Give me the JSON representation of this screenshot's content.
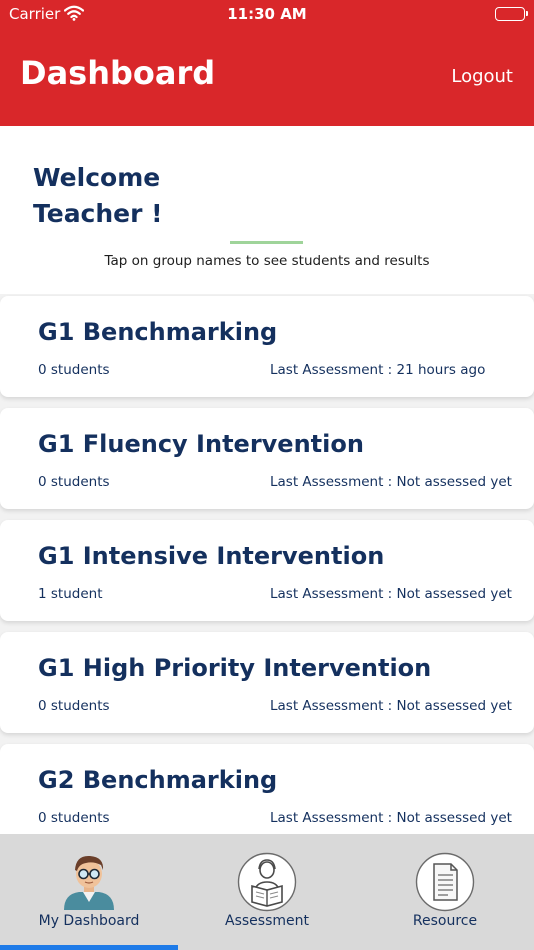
{
  "status": {
    "carrier": "Carrier",
    "time": "11:30 AM"
  },
  "header": {
    "title": "Dashboard",
    "logout_label": "Logout"
  },
  "welcome": {
    "line1": "Welcome",
    "line2": "Teacher !",
    "hint": "Tap on group names to see students and results"
  },
  "groups": [
    {
      "name": "G1 Benchmarking",
      "count": "0 students",
      "last": "Last Assessment : 21 hours ago"
    },
    {
      "name": "G1 Fluency Intervention",
      "count": "0 students",
      "last": "Last Assessment : Not assessed yet"
    },
    {
      "name": "G1 Intensive Intervention",
      "count": "1 student",
      "last": "Last Assessment : Not assessed yet"
    },
    {
      "name": "G1 High Priority Intervention",
      "count": "0 students",
      "last": "Last Assessment : Not assessed yet"
    },
    {
      "name": "G2 Benchmarking",
      "count": "0 students",
      "last": "Last Assessment : Not assessed yet"
    }
  ],
  "tabs": [
    {
      "label": "My Dashboard",
      "icon": "teacher-avatar-icon",
      "selected": true
    },
    {
      "label": "Assessment",
      "icon": "student-reading-icon",
      "selected": false
    },
    {
      "label": "Resource",
      "icon": "document-icon",
      "selected": false
    }
  ],
  "colors": {
    "brand": "#d9272a",
    "text": "#14305e",
    "tab_indicator": "#1e7be8",
    "divider": "#9fd49a"
  }
}
